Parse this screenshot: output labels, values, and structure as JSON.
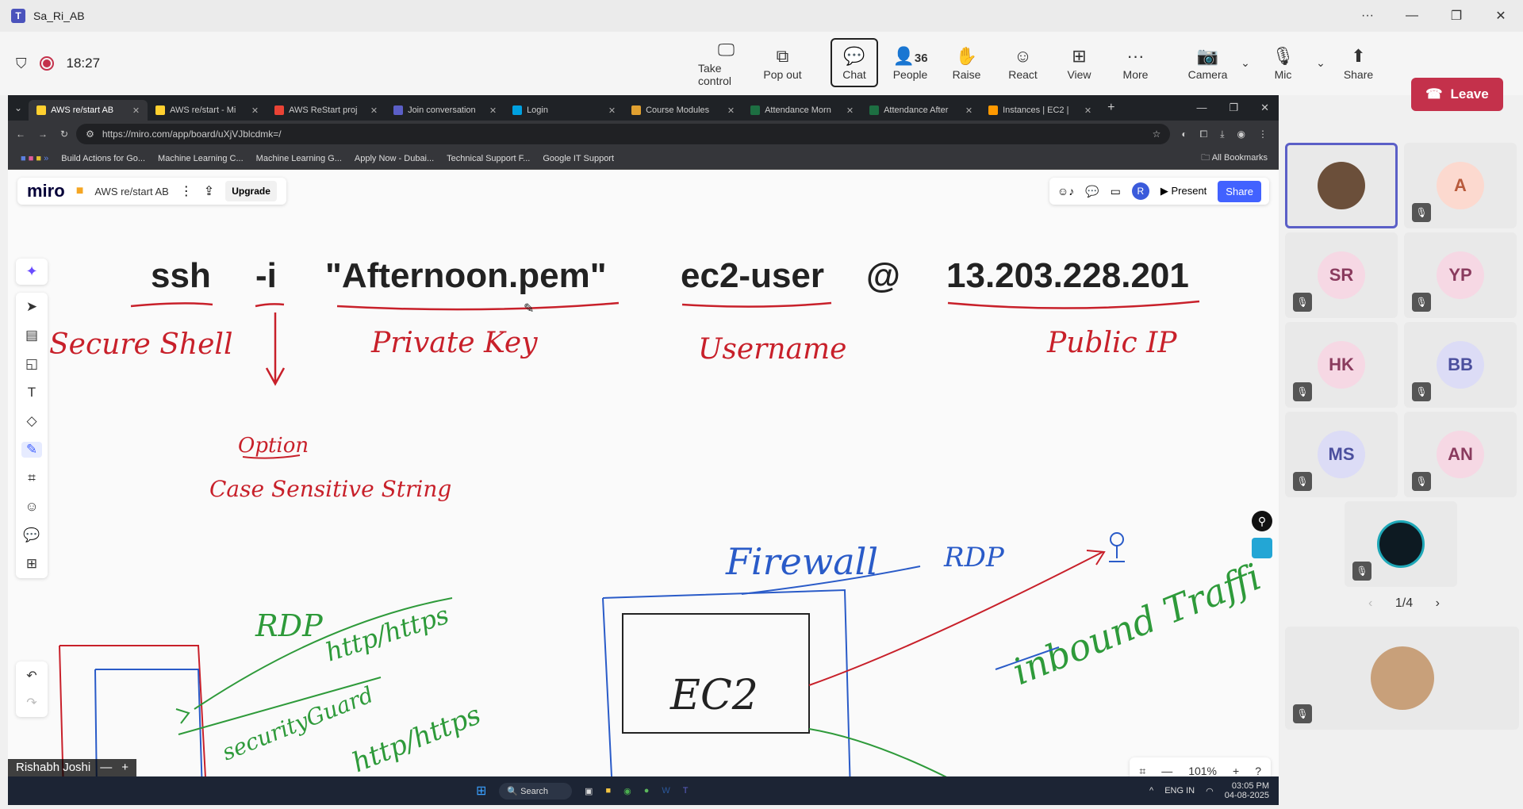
{
  "window": {
    "title": "Sa_Ri_AB"
  },
  "meeting": {
    "timer": "18:27",
    "tools": [
      {
        "label": "Take control",
        "icon": "take-control-icon"
      },
      {
        "label": "Pop out",
        "icon": "pop-out-icon"
      },
      {
        "label": "Chat",
        "icon": "chat-icon"
      },
      {
        "label": "People",
        "icon": "people-icon",
        "count": "36"
      },
      {
        "label": "Raise",
        "icon": "raise-hand-icon"
      },
      {
        "label": "React",
        "icon": "react-icon"
      },
      {
        "label": "View",
        "icon": "view-icon"
      },
      {
        "label": "More",
        "icon": "more-icon"
      },
      {
        "label": "Camera",
        "icon": "camera-off-icon"
      },
      {
        "label": "Mic",
        "icon": "mic-off-icon"
      },
      {
        "label": "Share",
        "icon": "share-icon"
      }
    ],
    "leave_label": "Leave"
  },
  "browser": {
    "tabs": [
      "AWS re/start AB",
      "AWS re/start - Mi",
      "AWS ReStart proj",
      "Join conversation",
      "Login",
      "Course Modules",
      "Attendance Morn",
      "Attendance After",
      "Instances | EC2 |"
    ],
    "url": "https://miro.com/app/board/uXjVJblcdmk=/",
    "bookmarks": [
      "Build Actions for Go...",
      "Machine Learning C...",
      "Machine Learning G...",
      "Apply Now - Dubai...",
      "Technical Support F...",
      "Google IT Support"
    ],
    "all_bookmarks": "All Bookmarks"
  },
  "miro": {
    "logo": "miro",
    "board_name": "AWS re/start AB",
    "upgrade": "Upgrade",
    "present": "Present",
    "share": "Share",
    "zoom": "101%",
    "command": {
      "ssh": "ssh",
      "flag": "-i",
      "key": "\"Afternoon.pem\"",
      "user": "ec2-user",
      "at": "@",
      "ip": "13.203.228.201"
    },
    "notes": {
      "secure_shell": "Secure Shell",
      "private_key": "Private Key",
      "username": "Username",
      "public_ip": "Public IP",
      "option": "Option",
      "case_sensitive": "Case Sensitive String",
      "firewall": "Firewall",
      "rdp": "RDP",
      "rdp2": "RDP",
      "http": "http/https",
      "security_guard": "securityGuard",
      "http2": "http/https",
      "ec2": "EC2",
      "inbound": "inbound Traffi"
    }
  },
  "taskbar": {
    "presenter": "Rishabh Joshi",
    "search": "Search",
    "lang": "ENG IN",
    "time": "03:05 PM",
    "date": "04-08-2025"
  },
  "participants": {
    "tiles": [
      {
        "initials": "",
        "photo": true
      },
      {
        "initials": "A"
      },
      {
        "initials": "SR"
      },
      {
        "initials": "YP"
      },
      {
        "initials": "HK"
      },
      {
        "initials": "BB"
      },
      {
        "initials": "MS"
      },
      {
        "initials": "AN"
      }
    ],
    "pager": "1/4"
  }
}
